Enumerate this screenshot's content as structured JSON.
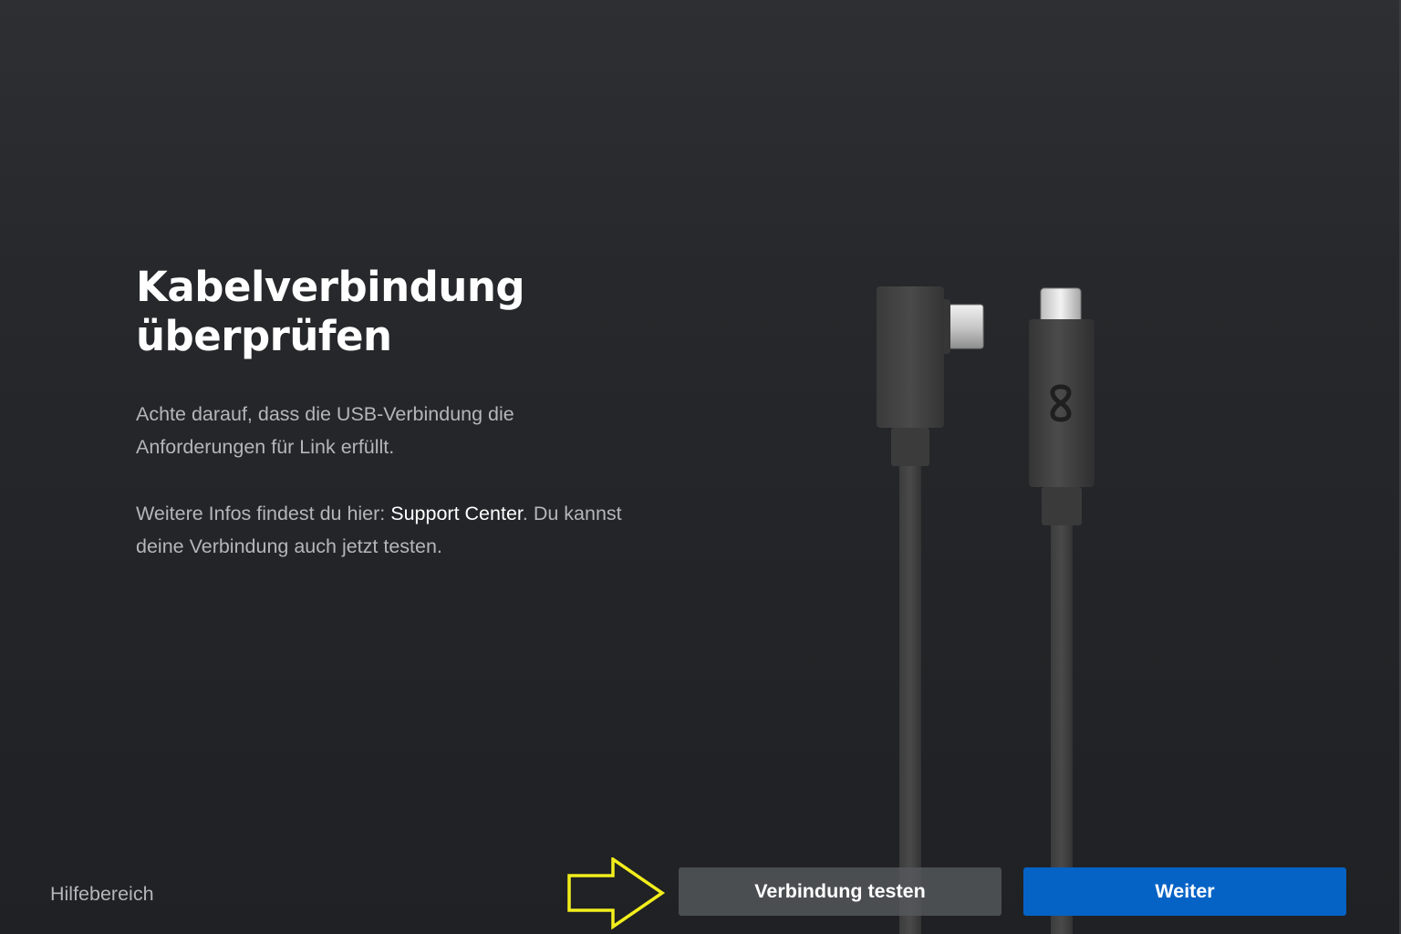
{
  "page": {
    "title_line1": "Kabelverbindung",
    "title_line2": "überprüfen",
    "description": "Achte darauf, dass die USB-Verbindung die Anforderungen für Link erfüllt.",
    "info_prefix": "Weitere Infos findest du hier: ",
    "info_link": "Support Center",
    "info_suffix": ". Du kannst deine Verbindung auch jetzt testen."
  },
  "footer": {
    "help_label": "Hilfebereich",
    "test_button_label": "Verbindung testen",
    "next_button_label": "Weiter"
  },
  "icons": {
    "illustration": "usb-c-cables-illustration",
    "annotation": "yellow-arrow-annotation",
    "logo": "meta-logo-icon"
  },
  "colors": {
    "primary_button": "#0563c6",
    "secondary_button": "#56585c",
    "annotation_arrow": "#f2ee1c",
    "background": "#232528"
  }
}
